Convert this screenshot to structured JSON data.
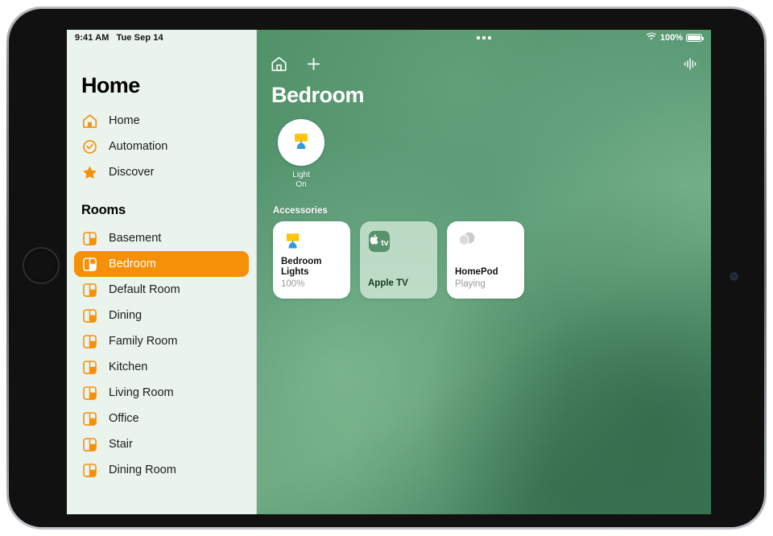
{
  "status_bar": {
    "time": "9:41 AM",
    "date": "Tue Sep 14",
    "battery_percent": "100%",
    "wifi_icon": "wifi-icon",
    "battery_icon": "battery-full-icon",
    "multitask_icon": "multitask-handle-icon"
  },
  "sidebar": {
    "title": "Home",
    "nav": [
      {
        "label": "Home",
        "icon": "house-icon"
      },
      {
        "label": "Automation",
        "icon": "clock-check-icon"
      },
      {
        "label": "Discover",
        "icon": "star-icon"
      }
    ],
    "rooms_header": "Rooms",
    "rooms": [
      {
        "label": "Basement",
        "icon": "room-icon"
      },
      {
        "label": "Bedroom",
        "icon": "room-icon"
      },
      {
        "label": "Default Room",
        "icon": "room-icon"
      },
      {
        "label": "Dining",
        "icon": "room-icon"
      },
      {
        "label": "Family Room",
        "icon": "room-icon"
      },
      {
        "label": "Kitchen",
        "icon": "room-icon"
      },
      {
        "label": "Living Room",
        "icon": "room-icon"
      },
      {
        "label": "Office",
        "icon": "room-icon"
      },
      {
        "label": "Stair",
        "icon": "room-icon"
      },
      {
        "label": "Dining Room",
        "icon": "room-icon"
      }
    ],
    "selected_room": "Bedroom",
    "accent_color": "#F79009",
    "background_color": "#eaf4ec"
  },
  "main": {
    "toolbar": {
      "home_icon": "house-outline-icon",
      "add_icon": "plus-icon",
      "airplay_icon": "audio-waveform-icon"
    },
    "room_title": "Bedroom",
    "status_tiles": [
      {
        "name": "Light",
        "state": "On",
        "icon": "lamp-icon"
      }
    ],
    "accessories_header": "Accessories",
    "accessories": [
      {
        "name": "Bedroom Lights",
        "state": "100%",
        "icon": "lamp-icon",
        "style": "solid"
      },
      {
        "name": "Apple TV",
        "state": "",
        "icon": "apple-tv-icon",
        "style": "translucent"
      },
      {
        "name": "HomePod",
        "state": "Playing",
        "icon": "homepod-icon",
        "style": "solid"
      }
    ],
    "background_color": "#4e8f66"
  }
}
